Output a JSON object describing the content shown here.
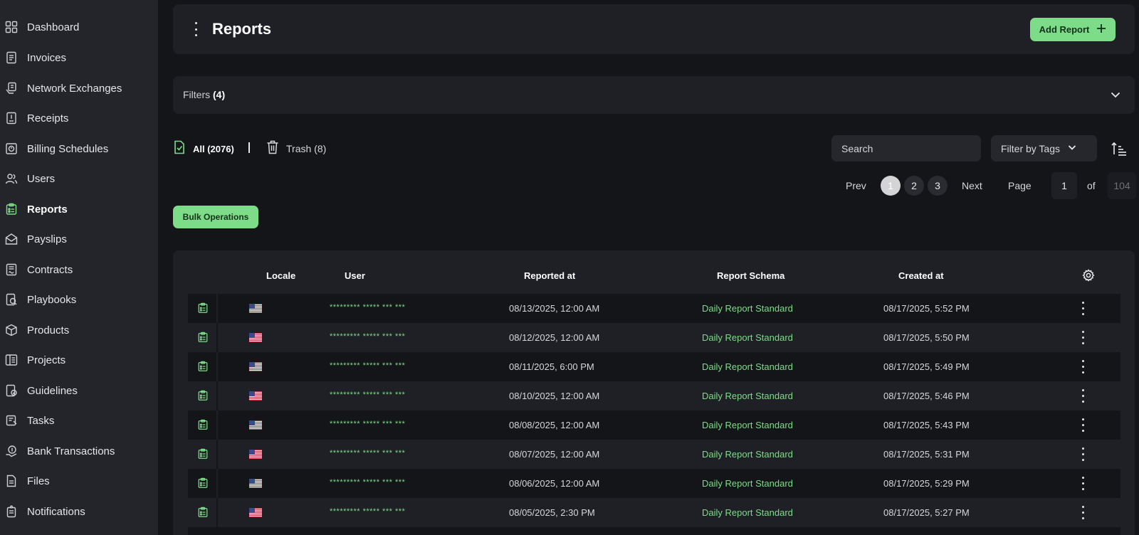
{
  "sidebar": {
    "items": [
      {
        "label": "Dashboard",
        "icon": "dashboard-icon"
      },
      {
        "label": "Invoices",
        "icon": "invoice-icon"
      },
      {
        "label": "Network Exchanges",
        "icon": "exchange-icon"
      },
      {
        "label": "Receipts",
        "icon": "receipt-icon"
      },
      {
        "label": "Billing Schedules",
        "icon": "billing-schedule-icon"
      },
      {
        "label": "Users",
        "icon": "users-icon"
      },
      {
        "label": "Reports",
        "icon": "report-icon",
        "active": true
      },
      {
        "label": "Payslips",
        "icon": "payslip-icon"
      },
      {
        "label": "Contracts",
        "icon": "contract-icon"
      },
      {
        "label": "Playbooks",
        "icon": "playbook-icon"
      },
      {
        "label": "Products",
        "icon": "product-box-icon"
      },
      {
        "label": "Projects",
        "icon": "project-icon"
      },
      {
        "label": "Guidelines",
        "icon": "guideline-icon"
      },
      {
        "label": "Tasks",
        "icon": "task-icon"
      },
      {
        "label": "Bank Transactions",
        "icon": "bank-transaction-icon"
      },
      {
        "label": "Files",
        "icon": "file-icon"
      },
      {
        "label": "Notifications",
        "icon": "notification-icon"
      }
    ]
  },
  "header": {
    "title": "Reports",
    "add_button": "Add Report"
  },
  "filters": {
    "label": "Filters",
    "count": "(4)"
  },
  "tabs": {
    "all": "All (2076)",
    "trash": "Trash (8)"
  },
  "search": {
    "placeholder": "Search"
  },
  "tag_filter": {
    "label": "Filter by Tags"
  },
  "pagination": {
    "prev": "Prev",
    "pages": [
      "1",
      "2",
      "3"
    ],
    "current": "1",
    "next": "Next",
    "page_label": "Page",
    "page_value": "1",
    "of_label": "of",
    "total": "104"
  },
  "bulk": {
    "label": "Bulk Operations"
  },
  "table": {
    "columns": {
      "locale": "Locale",
      "user": "User",
      "reported_at": "Reported at",
      "schema": "Report Schema",
      "created_at": "Created at"
    },
    "rows": [
      {
        "locale": "US",
        "user": "********* ***** *** ***",
        "reported_at": "08/13/2025, 12:00 AM",
        "schema": "Daily Report Standard",
        "created_at": "08/17/2025, 5:52 PM"
      },
      {
        "locale": "US",
        "user": "********* ***** *** ***",
        "reported_at": "08/12/2025, 12:00 AM",
        "schema": "Daily Report Standard",
        "created_at": "08/17/2025, 5:50 PM"
      },
      {
        "locale": "US",
        "user": "********* ***** *** ***",
        "reported_at": "08/11/2025, 6:00 PM",
        "schema": "Daily Report Standard",
        "created_at": "08/17/2025, 5:49 PM"
      },
      {
        "locale": "US",
        "user": "********* ***** *** ***",
        "reported_at": "08/10/2025, 12:00 AM",
        "schema": "Daily Report Standard",
        "created_at": "08/17/2025, 5:46 PM"
      },
      {
        "locale": "US",
        "user": "********* ***** *** ***",
        "reported_at": "08/08/2025, 12:00 AM",
        "schema": "Daily Report Standard",
        "created_at": "08/17/2025, 5:43 PM"
      },
      {
        "locale": "US",
        "user": "********* ***** *** ***",
        "reported_at": "08/07/2025, 12:00 AM",
        "schema": "Daily Report Standard",
        "created_at": "08/17/2025, 5:31 PM"
      },
      {
        "locale": "US",
        "user": "********* ***** *** ***",
        "reported_at": "08/06/2025, 12:00 AM",
        "schema": "Daily Report Standard",
        "created_at": "08/17/2025, 5:29 PM"
      },
      {
        "locale": "US",
        "user": "********* ***** *** ***",
        "reported_at": "08/05/2025, 2:30 PM",
        "schema": "Daily Report Standard",
        "created_at": "08/17/2025, 5:27 PM"
      }
    ]
  },
  "colors": {
    "accent": "#7ddc87",
    "background": "#141519",
    "sidebar": "#24252b",
    "card": "#1f2026"
  }
}
